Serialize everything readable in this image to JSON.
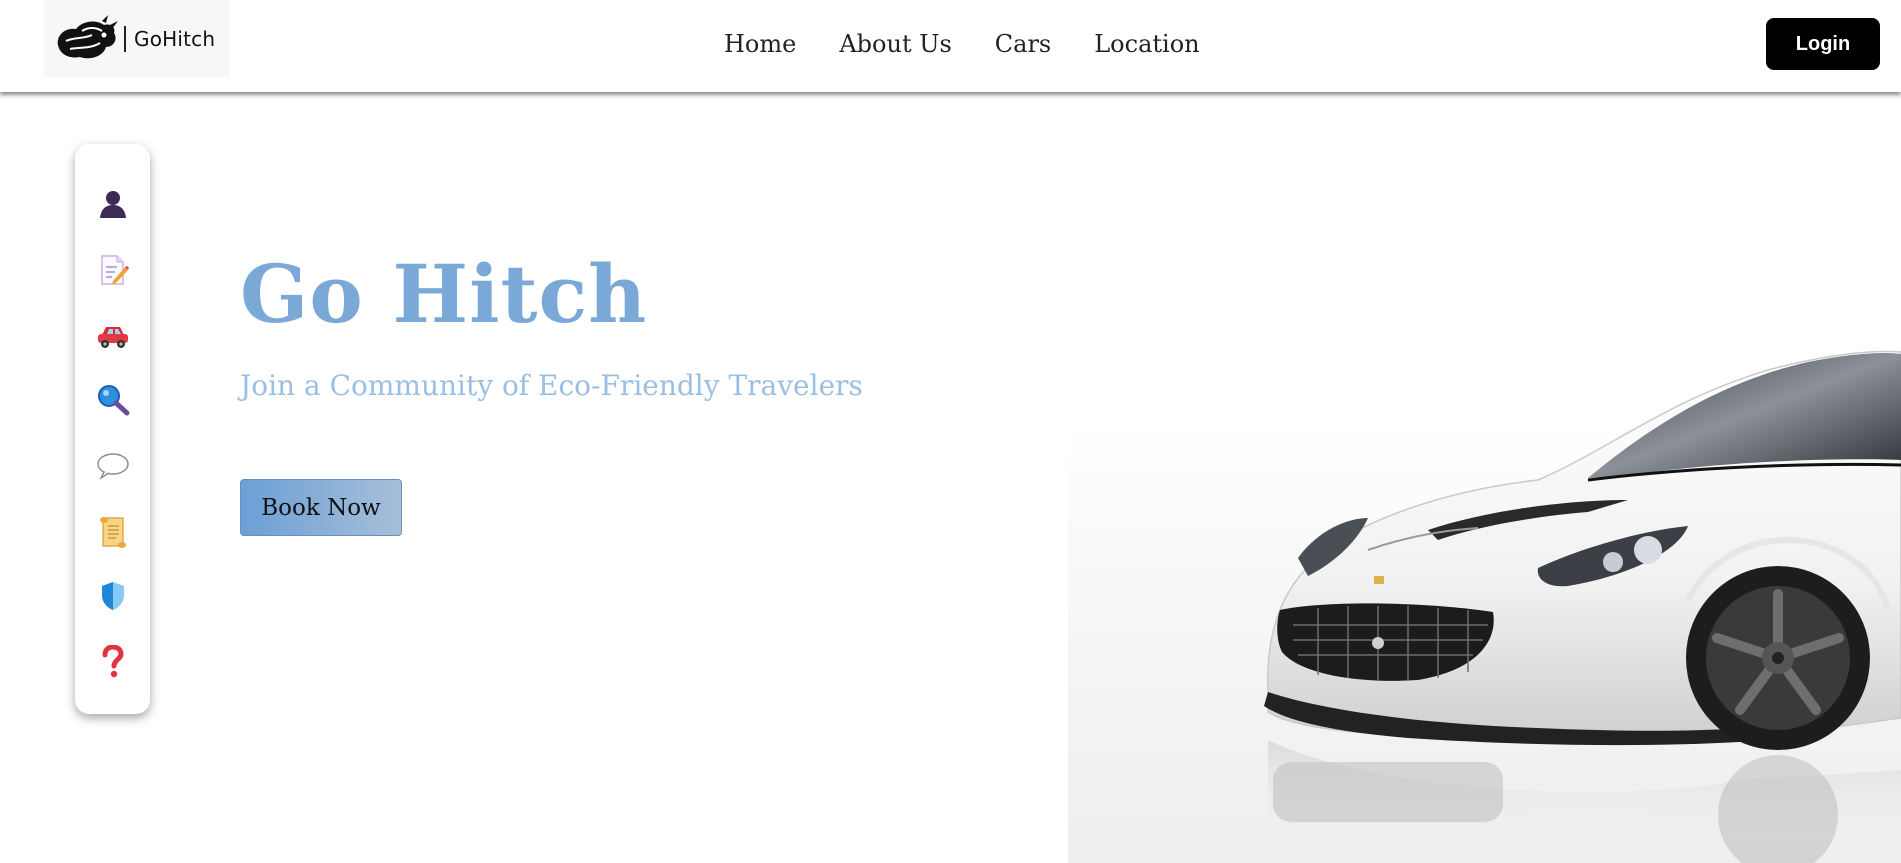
{
  "header": {
    "logo_text": "GoHitch",
    "nav": [
      "Home",
      "About Us",
      "Cars",
      "Location"
    ],
    "login_label": "Login"
  },
  "dock": {
    "icons": [
      "person-icon",
      "edit-document-icon",
      "car-icon",
      "search-icon",
      "chat-bubble-icon",
      "scroll-icon",
      "shield-icon",
      "help-icon"
    ]
  },
  "hero": {
    "title": "Go Hitch",
    "subtitle": "Join a Community of Eco-Friendly Travelers",
    "cta_label": "Book Now"
  },
  "colors": {
    "accent": "#7aa9d8",
    "subtitle": "#9bbfe3",
    "login_bg": "#000000"
  }
}
